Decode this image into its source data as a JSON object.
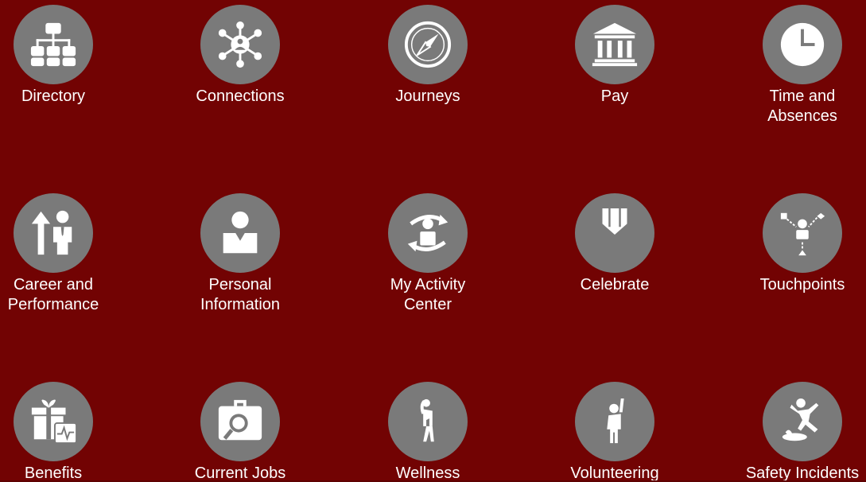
{
  "colors": {
    "background": "#720303",
    "icon_circle": "#7a7a7a",
    "icon_fg": "#ffffff",
    "label": "#ffffff"
  },
  "apps": [
    {
      "label": "Directory",
      "icon": "org-chart-icon"
    },
    {
      "label": "Connections",
      "icon": "network-hub-icon"
    },
    {
      "label": "Journeys",
      "icon": "compass-icon"
    },
    {
      "label": "Pay",
      "icon": "bank-building-icon"
    },
    {
      "label": "Time and\nAbsences",
      "icon": "clock-icon"
    },
    {
      "label": "Career and\nPerformance",
      "icon": "person-arrow-up-icon"
    },
    {
      "label": "Personal\nInformation",
      "icon": "person-icon"
    },
    {
      "label": "My Activity\nCenter",
      "icon": "person-refresh-icon"
    },
    {
      "label": "Celebrate",
      "icon": "badge-shield-icon"
    },
    {
      "label": "Touchpoints",
      "icon": "person-connections-icon"
    },
    {
      "label": "Benefits",
      "icon": "gift-heartbeat-icon"
    },
    {
      "label": "Current Jobs",
      "icon": "briefcase-search-icon"
    },
    {
      "label": "Wellness",
      "icon": "person-stretching-icon"
    },
    {
      "label": "Volunteering",
      "icon": "person-raising-hand-icon"
    },
    {
      "label": "Safety Incidents",
      "icon": "person-slipping-icon"
    }
  ]
}
